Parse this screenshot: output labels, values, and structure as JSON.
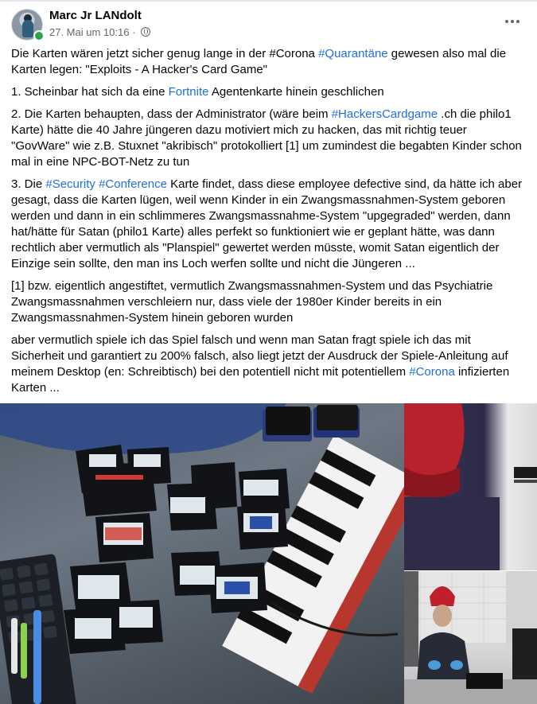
{
  "author": {
    "name": "Marc Jr LANdolt",
    "timestamp": "27. Mai um 10:16",
    "separator": " · ",
    "privacy_icon": "globe-icon",
    "status": "online"
  },
  "menu_icon": "more-options-icon",
  "post": {
    "p1": {
      "a": "Die Karten wären jetzt sicher genug lange in der #Corona ",
      "tag": "#Quarantäne",
      "b": " gewesen also mal die Karten legen: \"Exploits - A Hacker's Card Game\""
    },
    "p2": {
      "a": "1. Scheinbar hat sich da eine ",
      "tag": "Fortnite",
      "b": " Agentenkarte hinein geschlichen"
    },
    "p3": {
      "a": "2. Die Karten behaupten, dass der Administrator (wäre beim ",
      "tag": "#HackersCardgame",
      "b": " .ch die philo1 Karte) hätte die 40 Jahre jüngeren dazu motiviert mich zu hacken, das mit richtig teuer \"GovWare\" wie z.B. Stuxnet \"akribisch\" protokolliert [1] um zumindest die begabten Kinder schon mal in eine NPC-BOT-Netz zu tun"
    },
    "p4": {
      "a": "3. Die ",
      "tag1": "#Security",
      "sp": " ",
      "tag2": "#Conference",
      "b": " Karte findet, dass diese employee defective sind, da hätte ich aber gesagt, dass die Karten lügen, weil wenn Kinder in ein Zwangsmassnahmen-System geboren werden und dann in ein schlimmeres Zwangsmassnahme-System \"upgegraded\" werden, dann hat/hätte für Satan (philo1 Karte) alles perfekt so funktioniert wie er geplant hätte, was dann rechtlich aber vermutlich als \"Planspiel\" gewertet werden müsste, womit Satan eigentlich der Einzige sein sollte, den man ins Loch werfen sollte und nicht die Jüngeren ..."
    },
    "p5": "[1] bzw. eigentlich angestiftet, vermutlich Zwangsmassnahmen-System und das Psychiatrie Zwangsmassnahmen verschleiern nur, dass viele der 1980er Kinder bereits in ein Zwangsmassnahmen-System hinein geboren wurden",
    "p6": {
      "a": "aber vermutlich spiele ich das Spiel falsch und wenn man Satan fragt spiele ich das mit Sicherheit und garantiert zu 200% falsch, also liegt jetzt der Ausdruck der Spiele-Anleitung auf meinem Desktop (en: Schreibtisch) bei den potentiell nicht mit potentiellem ",
      "tag": "#Corona",
      "b": " infizierten Karten ..."
    }
  },
  "colors": {
    "link": "#216fdb",
    "meta": "#65676b",
    "online": "#31a24c"
  },
  "photos": {
    "main": "cards-on-table-photo",
    "top_right": "red-beanie-closeup-photo",
    "bottom_right": "person-at-desk-photo"
  }
}
